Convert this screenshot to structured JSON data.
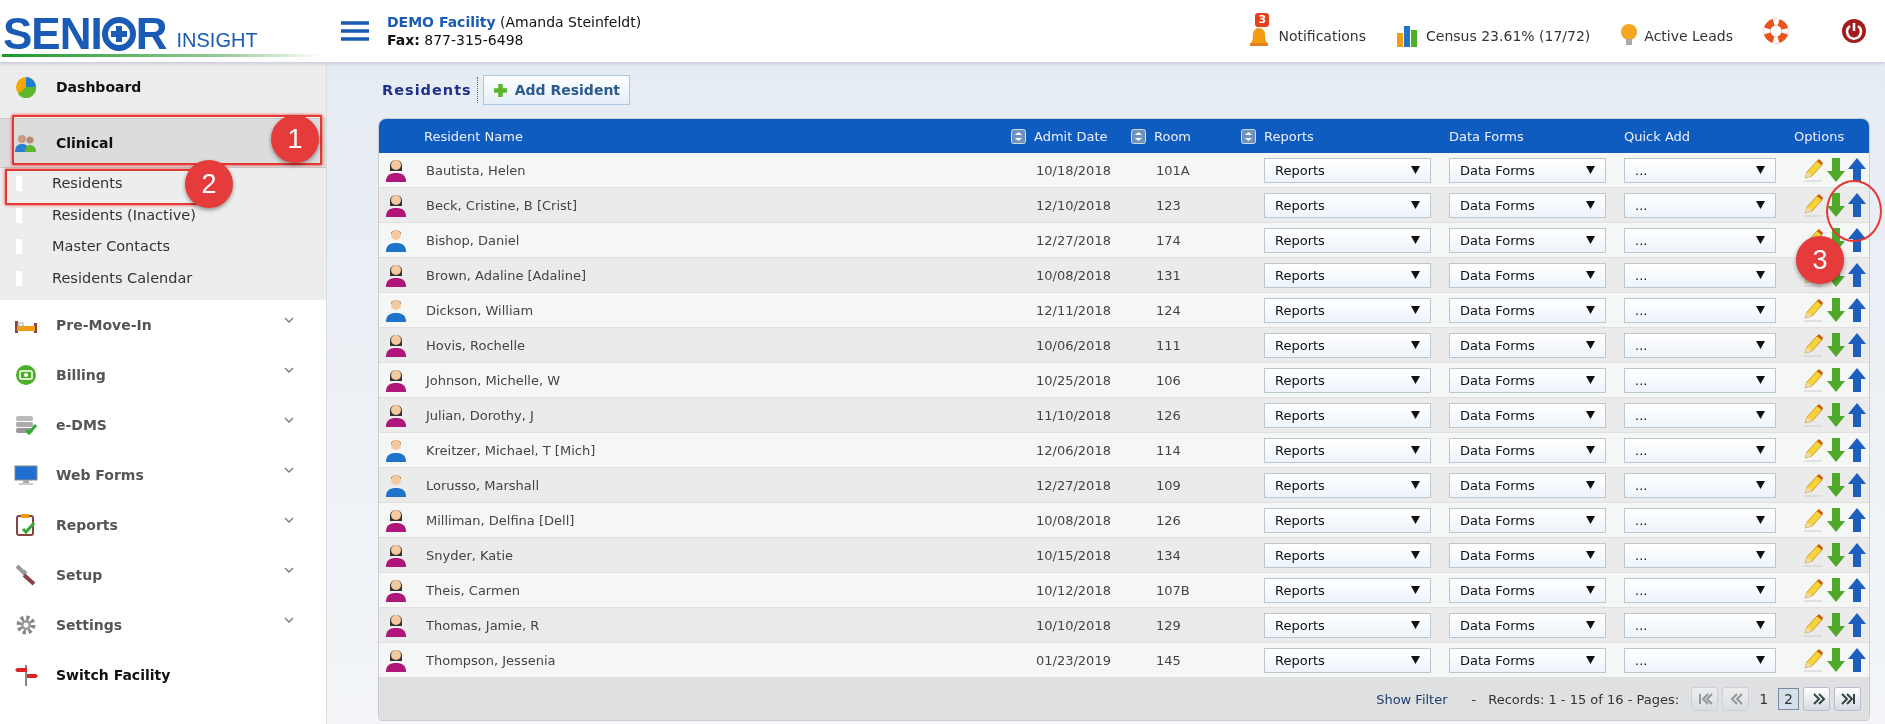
{
  "logo": {
    "left": "SENI",
    "right": "R",
    "tagline": "INSIGHT"
  },
  "facility": {
    "name": "DEMO Facility",
    "user": "(Amanda Steinfeldt)",
    "fax_label": "Fax:",
    "fax": "877-315-6498"
  },
  "header_links": [
    {
      "label": "Notifications",
      "badge": "3"
    },
    {
      "label": "Census 23.61% (17/72)"
    },
    {
      "label": "Active Leads"
    }
  ],
  "sidebar": {
    "items": [
      {
        "label": "Dashboard",
        "kind": "link",
        "selected": false
      },
      {
        "label": "Clinical",
        "kind": "group",
        "expanded": true,
        "selected": true,
        "children": [
          {
            "label": "Residents"
          },
          {
            "label": "Residents (Inactive)"
          },
          {
            "label": "Master Contacts"
          },
          {
            "label": "Residents Calendar"
          }
        ]
      },
      {
        "label": "Pre-Move-In",
        "kind": "group",
        "expanded": false,
        "selected": false
      },
      {
        "label": "Billing",
        "kind": "group",
        "expanded": false,
        "selected": false
      },
      {
        "label": "e-DMS",
        "kind": "group",
        "expanded": false,
        "selected": false
      },
      {
        "label": "Web Forms",
        "kind": "group",
        "expanded": false,
        "selected": false
      },
      {
        "label": "Reports",
        "kind": "group",
        "expanded": false,
        "selected": false
      },
      {
        "label": "Setup",
        "kind": "group",
        "expanded": false,
        "selected": false
      },
      {
        "label": "Settings",
        "kind": "group",
        "expanded": false,
        "selected": false
      },
      {
        "label": "Switch Facility",
        "kind": "link",
        "selected": false
      }
    ]
  },
  "page": {
    "title": "Residents",
    "add_button": "Add Resident"
  },
  "table": {
    "columns": [
      {
        "label": "Resident Name",
        "sortable": true
      },
      {
        "label": "Admit Date",
        "sortable": true
      },
      {
        "label": "Room",
        "sortable": true
      },
      {
        "label": "Reports",
        "sortable": false
      },
      {
        "label": "Data Forms",
        "sortable": false
      },
      {
        "label": "Quick Add",
        "sortable": false
      },
      {
        "label": "Options",
        "sortable": false
      }
    ],
    "rows": [
      {
        "kind": "female",
        "name": "Bautista, Helen",
        "admit_date": "10/18/2018",
        "room": "101A",
        "reports": "Reports",
        "data_forms": "Data Forms",
        "quick_add": "..."
      },
      {
        "kind": "female",
        "name": "Beck, Cristine, B [Crist]",
        "admit_date": "12/10/2018",
        "room": "123",
        "reports": "Reports",
        "data_forms": "Data Forms",
        "quick_add": "..."
      },
      {
        "kind": "male",
        "name": "Bishop, Daniel",
        "admit_date": "12/27/2018",
        "room": "174",
        "reports": "Reports",
        "data_forms": "Data Forms",
        "quick_add": "..."
      },
      {
        "kind": "female",
        "name": "Brown, Adaline [Adaline]",
        "admit_date": "10/08/2018",
        "room": "131",
        "reports": "Reports",
        "data_forms": "Data Forms",
        "quick_add": "..."
      },
      {
        "kind": "male",
        "name": "Dickson, William",
        "admit_date": "12/11/2018",
        "room": "124",
        "reports": "Reports",
        "data_forms": "Data Forms",
        "quick_add": "..."
      },
      {
        "kind": "female",
        "name": "Hovis, Rochelle",
        "admit_date": "10/06/2018",
        "room": "111",
        "reports": "Reports",
        "data_forms": "Data Forms",
        "quick_add": "..."
      },
      {
        "kind": "female",
        "name": "Johnson, Michelle, W",
        "admit_date": "10/25/2018",
        "room": "106",
        "reports": "Reports",
        "data_forms": "Data Forms",
        "quick_add": "..."
      },
      {
        "kind": "female",
        "name": "Julian, Dorothy, J",
        "admit_date": "11/10/2018",
        "room": "126",
        "reports": "Reports",
        "data_forms": "Data Forms",
        "quick_add": "..."
      },
      {
        "kind": "male",
        "name": "Kreitzer, Michael, T [Mich]",
        "admit_date": "12/06/2018",
        "room": "114",
        "reports": "Reports",
        "data_forms": "Data Forms",
        "quick_add": "..."
      },
      {
        "kind": "male",
        "name": "Lorusso, Marshall",
        "admit_date": "12/27/2018",
        "room": "109",
        "reports": "Reports",
        "data_forms": "Data Forms",
        "quick_add": "..."
      },
      {
        "kind": "female",
        "name": "Milliman, Delfina [Dell]",
        "admit_date": "10/08/2018",
        "room": "126",
        "reports": "Reports",
        "data_forms": "Data Forms",
        "quick_add": "..."
      },
      {
        "kind": "female",
        "name": "Snyder, Katie",
        "admit_date": "10/15/2018",
        "room": "134",
        "reports": "Reports",
        "data_forms": "Data Forms",
        "quick_add": "..."
      },
      {
        "kind": "female",
        "name": "Theis, Carmen",
        "admit_date": "10/12/2018",
        "room": "107B",
        "reports": "Reports",
        "data_forms": "Data Forms",
        "quick_add": "..."
      },
      {
        "kind": "female",
        "name": "Thomas, Jamie, R",
        "admit_date": "10/10/2018",
        "room": "129",
        "reports": "Reports",
        "data_forms": "Data Forms",
        "quick_add": "..."
      },
      {
        "kind": "female",
        "name": "Thompson, Jessenia",
        "admit_date": "01/23/2019",
        "room": "145",
        "reports": "Reports",
        "data_forms": "Data Forms",
        "quick_add": "..."
      }
    ]
  },
  "footer": {
    "show_filter": "Show Filter",
    "separator": "-",
    "records": "Records: 1 - 15 of 16 - Pages:",
    "pager": [
      {
        "kind": "first",
        "disabled": true
      },
      {
        "kind": "prev",
        "disabled": true
      },
      {
        "kind": "page",
        "label": "1",
        "selected": false
      },
      {
        "kind": "page",
        "label": "2",
        "selected": true
      },
      {
        "kind": "next",
        "disabled": false
      },
      {
        "kind": "last",
        "disabled": false
      }
    ]
  },
  "annotations": [
    {
      "label": "1"
    },
    {
      "label": "2"
    },
    {
      "label": "3"
    }
  ]
}
